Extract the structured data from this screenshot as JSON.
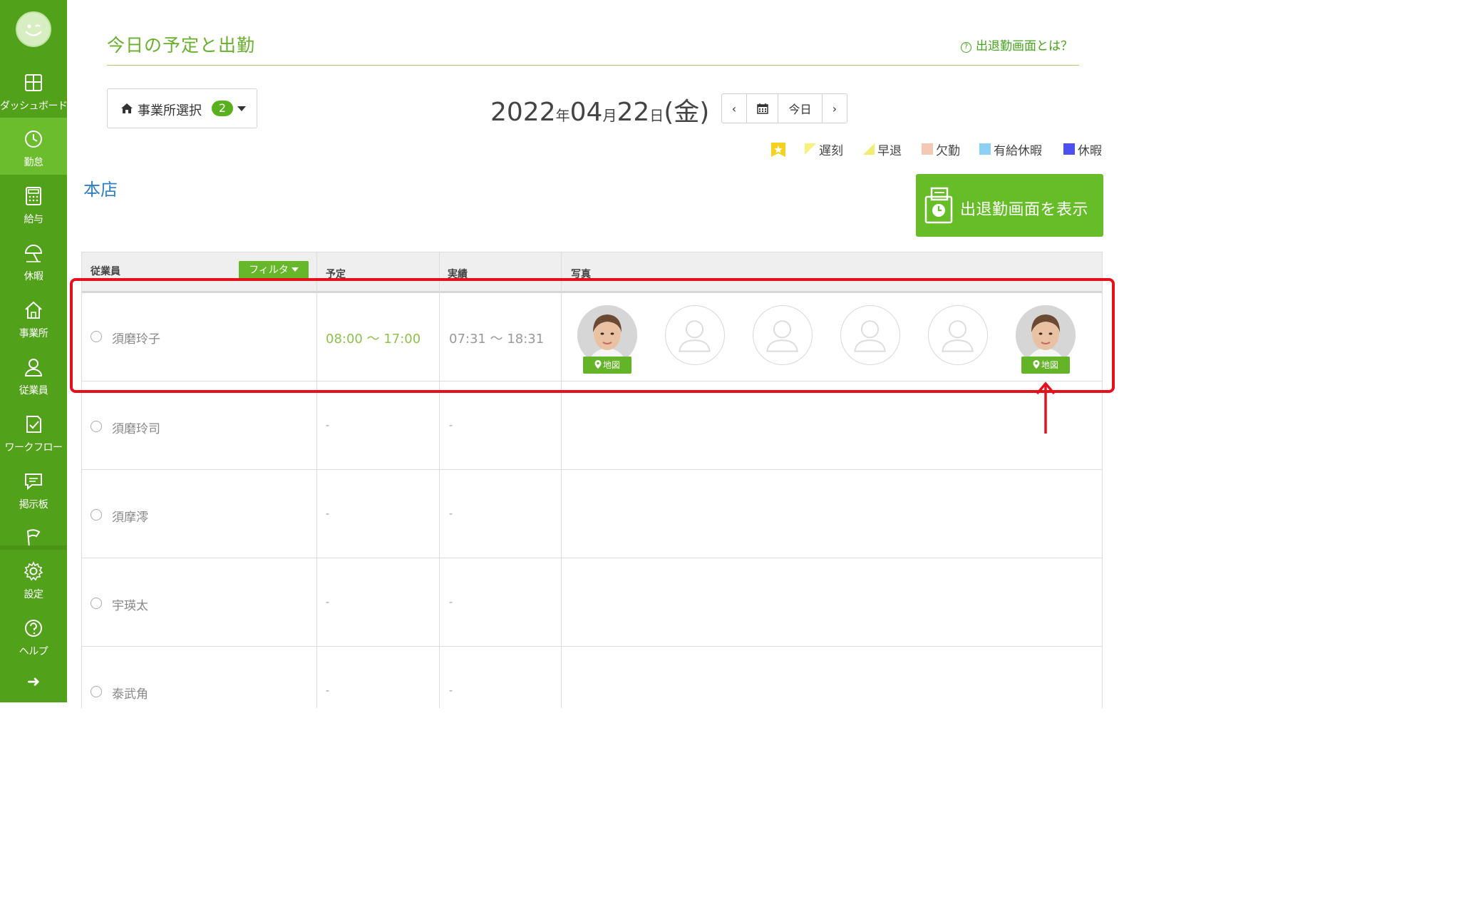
{
  "sidebar": {
    "items": [
      {
        "label": "ダッシュボード",
        "icon": "dashboard-icon"
      },
      {
        "label": "勤怠",
        "icon": "clock-icon"
      },
      {
        "label": "給与",
        "icon": "calculator-icon"
      },
      {
        "label": "休暇",
        "icon": "beach-umbrella-icon"
      },
      {
        "label": "事業所",
        "icon": "home-icon"
      },
      {
        "label": "従業員",
        "icon": "person-icon"
      },
      {
        "label": "ワークフロー",
        "icon": "checklist-icon"
      },
      {
        "label": "掲示板",
        "icon": "message-icon"
      },
      {
        "label": "",
        "icon": "flag-icon"
      },
      {
        "label": "設定",
        "icon": "gear-icon"
      },
      {
        "label": "ヘルプ",
        "icon": "help-icon"
      }
    ],
    "active_index": 1,
    "collapse_icon": "arrow-right-icon",
    "accent": "#52a11b"
  },
  "header": {
    "title": "今日の予定と出勤",
    "help_link": "出退勤画面とは？"
  },
  "office_select": {
    "label": "事業所選択",
    "count": "2"
  },
  "date": {
    "year": "2022",
    "year_unit": "年",
    "month": "04",
    "month_unit": "月",
    "day": "22",
    "day_unit": "日",
    "weekday": "(金)"
  },
  "date_nav": {
    "prev": "‹",
    "today": "今日",
    "next": "›"
  },
  "legend": {
    "items": [
      {
        "label": "",
        "color": "#f5d120"
      },
      {
        "label": "遅刻",
        "color": "#f7f07a"
      },
      {
        "label": "早退",
        "color": "#f1ec72"
      },
      {
        "label": "欠勤",
        "color": "#f4c8b2"
      },
      {
        "label": "有給休暇",
        "color": "#8ed0f5"
      },
      {
        "label": "休暇",
        "color": "#4b50ef"
      }
    ]
  },
  "office_name": "本店",
  "show_button": "出退勤画面を表示",
  "table": {
    "headers": {
      "employee": "従業員",
      "filter": "フィルタ",
      "plan": "予定",
      "actual": "実績",
      "photo": "写真"
    },
    "rows": [
      {
        "name": "須磨玲子",
        "plan": "08:00 〜 17:00",
        "actual": "07:31 〜 18:31"
      },
      {
        "name": "須磨玲司",
        "plan": "-",
        "actual": "-"
      },
      {
        "name": "須摩澪",
        "plan": "-",
        "actual": "-"
      },
      {
        "name": "宇瑛太",
        "plan": "-",
        "actual": "-"
      },
      {
        "name": "泰武角",
        "plan": "-",
        "actual": "-"
      }
    ],
    "map_label": "地図"
  }
}
